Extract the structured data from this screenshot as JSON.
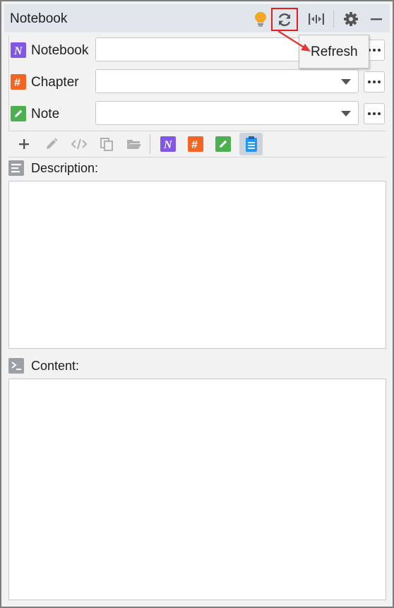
{
  "header": {
    "title": "Notebook",
    "icons": [
      "lightbulb-icon",
      "refresh-icon",
      "fit-width-icon",
      "gear-icon",
      "minimize-icon"
    ]
  },
  "form": {
    "notebook_label": "Notebook",
    "chapter_label": "Chapter",
    "note_label": "Note",
    "notebook_value": "",
    "chapter_value": "",
    "note_value": ""
  },
  "toolbar": {
    "icons": [
      "add-icon",
      "edit-icon",
      "code-icon",
      "copy-icon",
      "folder-icon",
      "notebook-icon",
      "chapter-icon",
      "note-icon",
      "clipboard-icon"
    ]
  },
  "description": {
    "title": "Description:",
    "value": ""
  },
  "content": {
    "title": "Content:",
    "value": ""
  },
  "tooltip": {
    "text": "Refresh"
  },
  "colors": {
    "notebook": "#8257e6",
    "chapter": "#f26522",
    "note": "#4caf50",
    "clipboard": "#2196f3",
    "highlight": "#e02020",
    "bulb": "#f5a623"
  }
}
